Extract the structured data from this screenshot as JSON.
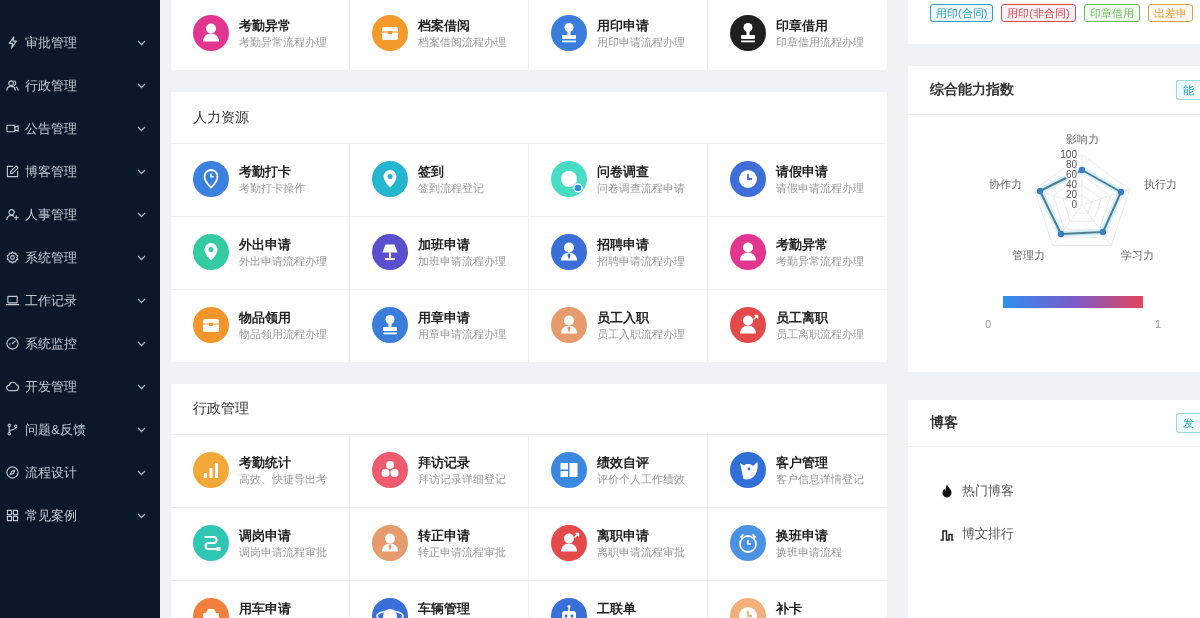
{
  "sidebar": {
    "items": [
      {
        "label": "审批管理",
        "expanded": false
      },
      {
        "label": "行政管理",
        "expanded": false
      },
      {
        "label": "公告管理",
        "expanded": false
      },
      {
        "label": "博客管理",
        "expanded": false
      },
      {
        "label": "人事管理",
        "expanded": false
      },
      {
        "label": "系统管理",
        "expanded": false
      },
      {
        "label": "工作记录",
        "expanded": false
      },
      {
        "label": "系统监控",
        "expanded": false
      },
      {
        "label": "开发管理",
        "expanded": false
      },
      {
        "label": "问题&反馈",
        "expanded": false
      },
      {
        "label": "流程设计",
        "expanded": false
      },
      {
        "label": "常见案例",
        "expanded": false
      }
    ]
  },
  "top_tiles": {
    "items": [
      {
        "title": "考勤异常",
        "subtitle": "考勤异常流程办理",
        "color": "#e2358f"
      },
      {
        "title": "档案借阅",
        "subtitle": "档案借阅流程办理",
        "color": "#f39a2b"
      },
      {
        "title": "用印申请",
        "subtitle": "用印申请流程办理",
        "color": "#3b7ddd"
      },
      {
        "title": "印章借用",
        "subtitle": "印章借用流程办理",
        "color": "#1f1f1f"
      }
    ]
  },
  "sections": [
    {
      "title": "人力资源",
      "items": [
        {
          "title": "考勤打卡",
          "subtitle": "考勤打卡操作",
          "color": "#3b82e0"
        },
        {
          "title": "签到",
          "subtitle": "签到流程登记",
          "color": "#25b6cf"
        },
        {
          "title": "问卷调查",
          "subtitle": "问卷调查流程申请",
          "color": "#48dcc4"
        },
        {
          "title": "请假申请",
          "subtitle": "请假申请流程办理",
          "color": "#3e6ed8"
        },
        {
          "title": "外出申请",
          "subtitle": "外出申请流程办理",
          "color": "#34cba3"
        },
        {
          "title": "加班申请",
          "subtitle": "加班申请流程办理",
          "color": "#5a4fcf"
        },
        {
          "title": "招聘申请",
          "subtitle": "招聘申请流程办理",
          "color": "#3b6fd8"
        },
        {
          "title": "考勤异常",
          "subtitle": "考勤异常流程办理",
          "color": "#e2358f"
        },
        {
          "title": "物品领用",
          "subtitle": "物品领用流程办理",
          "color": "#f2952a"
        },
        {
          "title": "用章申请",
          "subtitle": "用章申请流程办理",
          "color": "#3b7ddd"
        },
        {
          "title": "员工入职",
          "subtitle": "员工入职流程办理",
          "color": "#e59b6b"
        },
        {
          "title": "员工离职",
          "subtitle": "员工离职流程办理",
          "color": "#e44a4a"
        }
      ]
    },
    {
      "title": "行政管理",
      "items": [
        {
          "title": "考勤统计",
          "subtitle": "高效、快捷导出考",
          "color": "#f5a83a"
        },
        {
          "title": "拜访记录",
          "subtitle": "拜访记录详细登记",
          "color": "#ee5b6c"
        },
        {
          "title": "绩效自评",
          "subtitle": "评价个人工作绩效",
          "color": "#3a88e0"
        },
        {
          "title": "客户管理",
          "subtitle": "客户信息详情登记",
          "color": "#2f6fd6"
        },
        {
          "title": "调岗申请",
          "subtitle": "调岗申请流程审批",
          "color": "#2fc6b3"
        },
        {
          "title": "转正申请",
          "subtitle": "转正申请流程审批",
          "color": "#e59b6b"
        },
        {
          "title": "离职申请",
          "subtitle": "离职申请流程审批",
          "color": "#e44a4a"
        },
        {
          "title": "换班申请",
          "subtitle": "换班申请流程",
          "color": "#4a92e3"
        },
        {
          "title": "用车申请",
          "color": "#f0803c"
        },
        {
          "title": "车辆管理",
          "color": "#3a6fd8"
        },
        {
          "title": "工联单",
          "color": "#3a6fd8"
        },
        {
          "title": "补卡",
          "color": "#f2b07a"
        }
      ]
    }
  ],
  "quick_tags": [
    {
      "label": "用印(合同)",
      "color": "#2fa3bd"
    },
    {
      "label": "用印(非合同)",
      "color": "#d84a5a"
    },
    {
      "label": "印章借用",
      "color": "#6dbb5f"
    },
    {
      "label": "出差申",
      "color": "#d9a444"
    }
  ],
  "ability_card": {
    "title": "综合能力指数",
    "button": "能",
    "radar": {
      "indicators": [
        "影响力",
        "执行力",
        "学习力",
        "管理力",
        "协作力"
      ],
      "axis_ticks": [
        "100",
        "80",
        "60",
        "40",
        "20",
        "0"
      ]
    },
    "legend": {
      "min_label": "0",
      "max_label": "1"
    }
  },
  "blog_card": {
    "title": "博客",
    "button": "发",
    "links": [
      {
        "label": "热门博客"
      },
      {
        "label": "博文排行"
      }
    ]
  }
}
